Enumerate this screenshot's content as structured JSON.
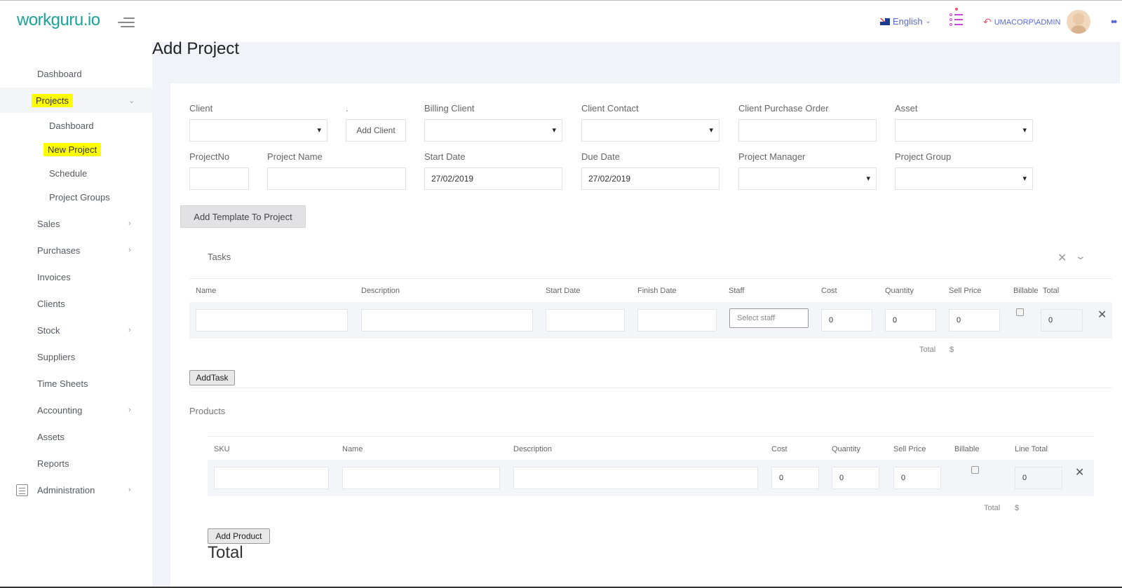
{
  "header": {
    "logo": "workguru.io",
    "language": "English",
    "user": "UMACORP\\ADMIN"
  },
  "sidebar": {
    "items": [
      {
        "label": "Dashboard"
      },
      {
        "label": "Projects"
      },
      {
        "label": "Sales"
      },
      {
        "label": "Purchases"
      },
      {
        "label": "Invoices"
      },
      {
        "label": "Clients"
      },
      {
        "label": "Stock"
      },
      {
        "label": "Suppliers"
      },
      {
        "label": "Time Sheets"
      },
      {
        "label": "Accounting"
      },
      {
        "label": "Assets"
      },
      {
        "label": "Reports"
      },
      {
        "label": "Administration"
      }
    ],
    "project_sub": [
      {
        "label": "Dashboard"
      },
      {
        "label": "New Project"
      },
      {
        "label": "Schedule"
      },
      {
        "label": "Project Groups"
      }
    ]
  },
  "page": {
    "title": "Add Project"
  },
  "form": {
    "client_label": "Client",
    "dot_label": ".",
    "add_client": "Add Client",
    "billing_client_label": "Billing Client",
    "client_contact_label": "Client Contact",
    "client_po_label": "Client Purchase Order",
    "asset_label": "Asset",
    "project_no_label": "ProjectNo",
    "project_name_label": "Project Name",
    "start_date_label": "Start Date",
    "start_date_value": "27/02/2019",
    "due_date_label": "Due Date",
    "due_date_value": "27/02/2019",
    "project_manager_label": "Project Manager",
    "project_group_label": "Project Group",
    "add_template": "Add Template To Project"
  },
  "tasks": {
    "title": "Tasks",
    "columns": [
      "Name",
      "Description",
      "Start Date",
      "Finish Date",
      "Staff",
      "Cost",
      "Quantity",
      "Sell Price",
      "Billable",
      "Total"
    ],
    "row": {
      "staff_placeholder": "Select staff",
      "cost": "0",
      "quantity": "0",
      "sell_price": "0",
      "total": "0"
    },
    "total_label": "Total",
    "total_value": "$",
    "add_task": "AddTask"
  },
  "products": {
    "title": "Products",
    "columns": [
      "SKU",
      "Name",
      "Description",
      "Cost",
      "Quantity",
      "Sell Price",
      "Billable",
      "Line Total"
    ],
    "row": {
      "cost": "0",
      "quantity": "0",
      "sell_price": "0",
      "line_total": "0"
    },
    "total_label": "Total",
    "total_value": "$",
    "add_product": "Add Product"
  },
  "footer": {
    "total_heading": "Total"
  }
}
